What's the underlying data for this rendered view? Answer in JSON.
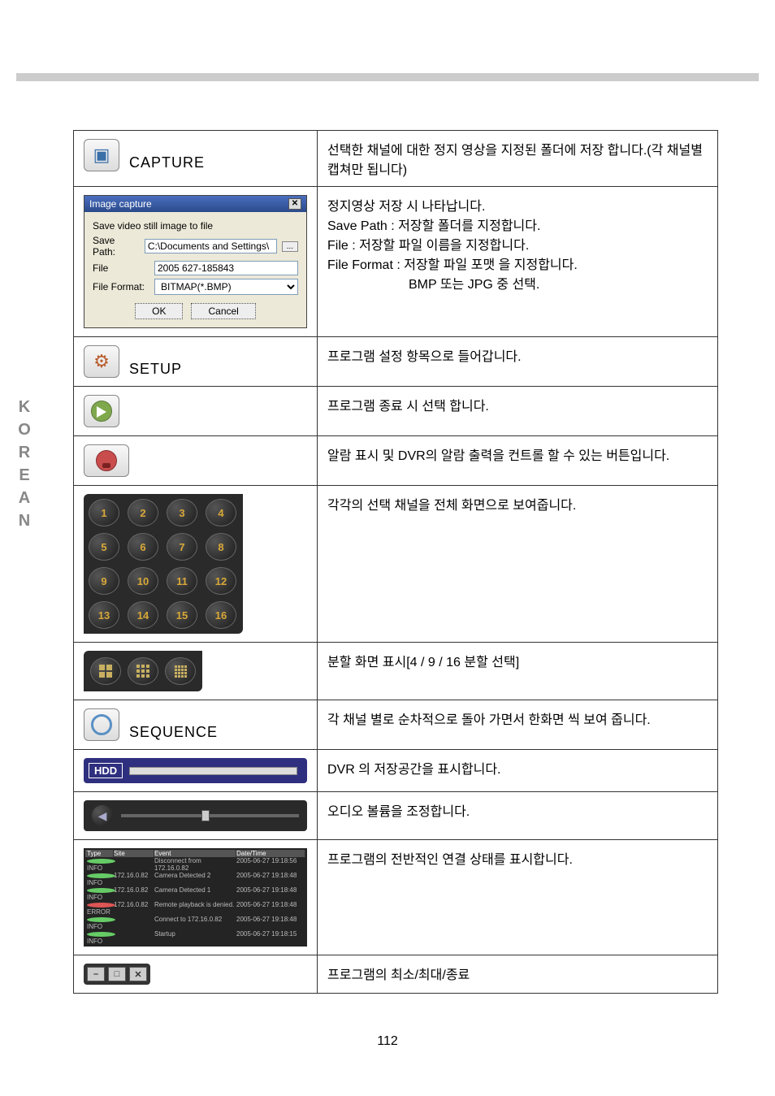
{
  "side_label": "KOREAN",
  "page_number": "112",
  "rows": {
    "capture": {
      "label": "CAPTURE",
      "desc": "선택한 채널에 대한 정지 영상을 지정된 폴더에 저장 합니다.(각 채널별 캡쳐만 됩니다)"
    },
    "dialog": {
      "title": "Image capture",
      "subtitle": "Save video still image to file",
      "savepath_label": "Save Path:",
      "savepath_value": "C:\\Documents and Settings\\",
      "file_label": "File",
      "file_value": "2005 627-185843",
      "format_label": "File Format:",
      "format_value": "BITMAP(*.BMP)",
      "ok": "OK",
      "cancel": "Cancel",
      "browse": "...",
      "desc_l1": "정지영상 저장 시 나타납니다.",
      "desc_l2": "Save Path : 저장할 폴더를 지정합니다.",
      "desc_l3": "File : 저장할 파일 이름을 지정합니다.",
      "desc_l4": "File Format : 저장할 파일 포맷 을 지정합니다.",
      "desc_l5": "BMP 또는 JPG 중 선택."
    },
    "setup": {
      "label": "SETUP",
      "desc": "프로그램 설정 항목으로 들어갑니다."
    },
    "exit": {
      "desc": "프로그램 종료 시 선택 합니다."
    },
    "alarm": {
      "desc": "알람 표시 및 DVR의 알람 출력을 컨트롤 할 수 있는 버튼입니다."
    },
    "channels": {
      "desc": "각각의 선택 채널을 전체 화면으로 보여줍니다.",
      "nums": [
        "1",
        "2",
        "3",
        "4",
        "5",
        "6",
        "7",
        "8",
        "9",
        "10",
        "11",
        "12",
        "13",
        "14",
        "15",
        "16"
      ]
    },
    "split": {
      "desc": "분할 화면 표시[4 / 9 / 16 분할 선택]"
    },
    "sequence": {
      "label": "SEQUENCE",
      "desc": "각 채널 별로 순차적으로 돌아 가면서 한화면 씩 보여 줍니다."
    },
    "hdd": {
      "label": "HDD",
      "desc": "DVR 의 저장공간을 표시합니다."
    },
    "volume": {
      "desc": "오디오 볼륨을 조정합니다."
    },
    "status": {
      "desc": "프로그램의 전반적인 연결 상태를 표시합니다.",
      "headers": [
        "Type",
        "Site",
        "Event",
        "Date/Time"
      ],
      "rows": [
        {
          "type": "INFO",
          "site": "",
          "event": "Disconnect from 172.16.0.82",
          "date": "2005-06-27 19:18:56",
          "dot": "g"
        },
        {
          "type": "INFO",
          "site": "172.16.0.82",
          "event": "Camera Detected 2",
          "date": "2005-06-27 19:18:48",
          "dot": "g"
        },
        {
          "type": "INFO",
          "site": "172.16.0.82",
          "event": "Camera Detected 1",
          "date": "2005-06-27 19:18:48",
          "dot": "g"
        },
        {
          "type": "ERROR",
          "site": "172.16.0.82",
          "event": "Remote playback is denied.",
          "date": "2005-06-27 19:18:48",
          "dot": "r"
        },
        {
          "type": "INFO",
          "site": "",
          "event": "Connect to 172.16.0.82",
          "date": "2005-06-27 19:18:48",
          "dot": "g"
        },
        {
          "type": "INFO",
          "site": "",
          "event": "Startup",
          "date": "2005-06-27 19:18:15",
          "dot": "g"
        }
      ]
    },
    "wctrl": {
      "desc": "프로그램의 최소/최대/종료"
    }
  }
}
